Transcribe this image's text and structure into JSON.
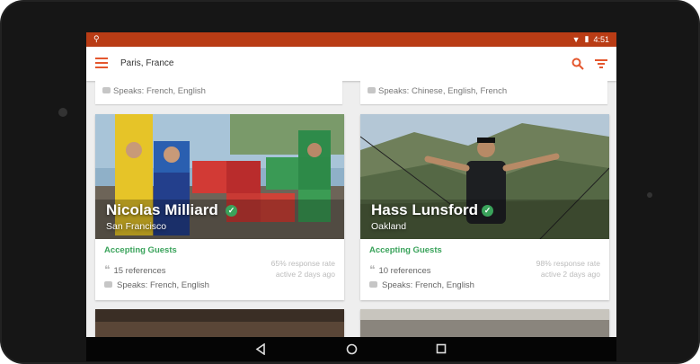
{
  "status": {
    "time": "4:51"
  },
  "header": {
    "location": "Paris, France"
  },
  "icons": {
    "menu": "hamburger-menu-icon",
    "search": "search-icon",
    "filter": "filter-icon",
    "verified": "check-circle-icon",
    "quote": "quote-icon",
    "speech": "speech-bubble-icon",
    "back": "back-triangle-icon",
    "home": "home-circle-icon",
    "recents": "recents-square-icon"
  },
  "top_snippets": [
    {
      "speaks": "Speaks: French, English"
    },
    {
      "speaks": "Speaks: Chinese, English, French"
    }
  ],
  "cards": [
    {
      "name": "Nicolas Milliard",
      "city": "San Francisco",
      "status": "Accepting Guests",
      "references": "15 references",
      "response_rate": "65% response rate",
      "active": "active 2 days ago",
      "speaks": "Speaks: French, English"
    },
    {
      "name": "Hass Lunsford",
      "city": "Oakland",
      "status": "Accepting Guests",
      "references": "10 references",
      "response_rate": "98% response rate",
      "active": "active 2 days ago",
      "speaks": "Speaks: French, English"
    }
  ],
  "colors": {
    "accent": "#e4572e",
    "statusbar": "#b93c15",
    "green": "#3aa35b"
  }
}
